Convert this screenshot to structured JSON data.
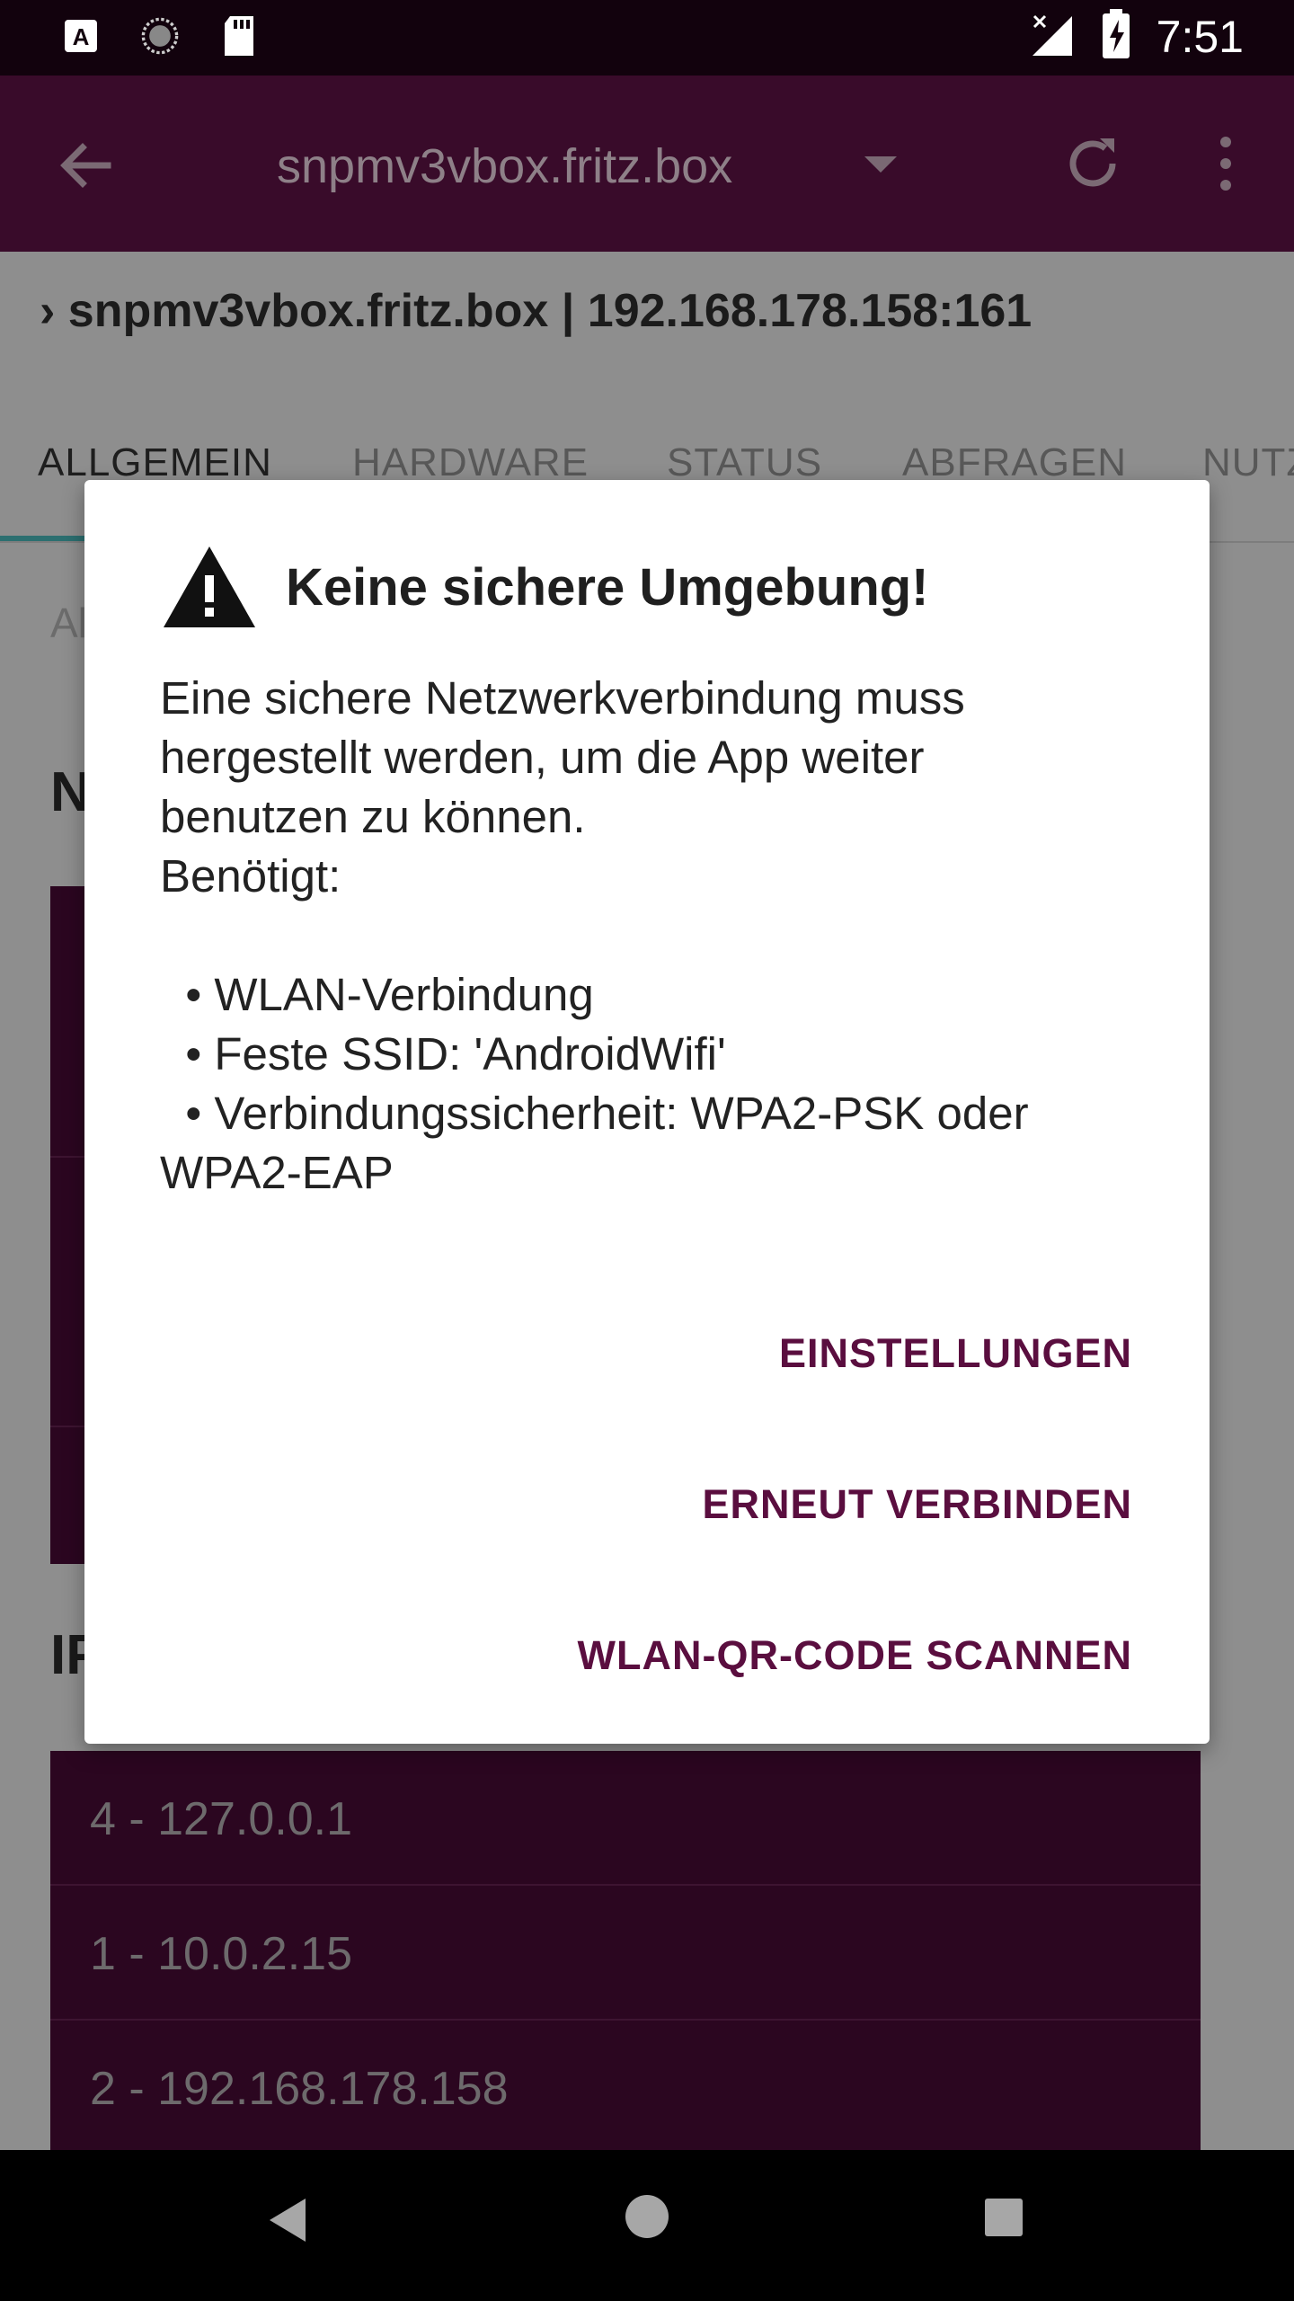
{
  "status_bar": {
    "time": "7:51",
    "left_icons": [
      "text-a-icon",
      "sync-circle-icon",
      "sd-card-icon"
    ],
    "right_icons": [
      "signal-no-data-icon",
      "battery-charging-icon"
    ]
  },
  "toolbar": {
    "title": "snpmv3vbox.fritz.box",
    "icons": [
      "back-arrow-icon",
      "dropdown-icon",
      "refresh-icon",
      "more-vert-icon"
    ]
  },
  "breadcrumb": {
    "chevron": "›",
    "text": "snpmv3vbox.fritz.box | 192.168.178.158:161"
  },
  "tabs": [
    {
      "label": "ALLGEMEIN"
    },
    {
      "label": "HARDWARE"
    },
    {
      "label": "STATUS"
    },
    {
      "label": "ABFRAGEN"
    },
    {
      "label": "NUTZ"
    }
  ],
  "background": {
    "partial_label": "Al",
    "section1_heading": "N",
    "section2_heading": "IP",
    "ip_rows": [
      "4 - 127.0.0.1",
      "1 - 10.0.2.15",
      "2 - 192.168.178.158"
    ]
  },
  "dialog": {
    "title": "Keine sichere Umgebung!",
    "body_lines": [
      "Eine sichere Netzwerkverbindung muss",
      "hergestellt werden, um die App weiter",
      "benutzen zu können.",
      "Benötigt:",
      "",
      "  • WLAN-Verbindung",
      "  • Feste SSID: 'AndroidWifi'",
      "  • Verbindungssicherheit: WPA2-PSK oder",
      "WPA2-EAP"
    ],
    "buttons": {
      "settings": "EINSTELLUNGEN",
      "reconnect": "ERNEUT VERBINDEN",
      "scan": "WLAN-QR-CODE SCANNEN"
    }
  },
  "colors": {
    "primary_dark": "#390b2a",
    "accent": "#5a0e3f",
    "tab_indicator": "#2c6f70"
  }
}
